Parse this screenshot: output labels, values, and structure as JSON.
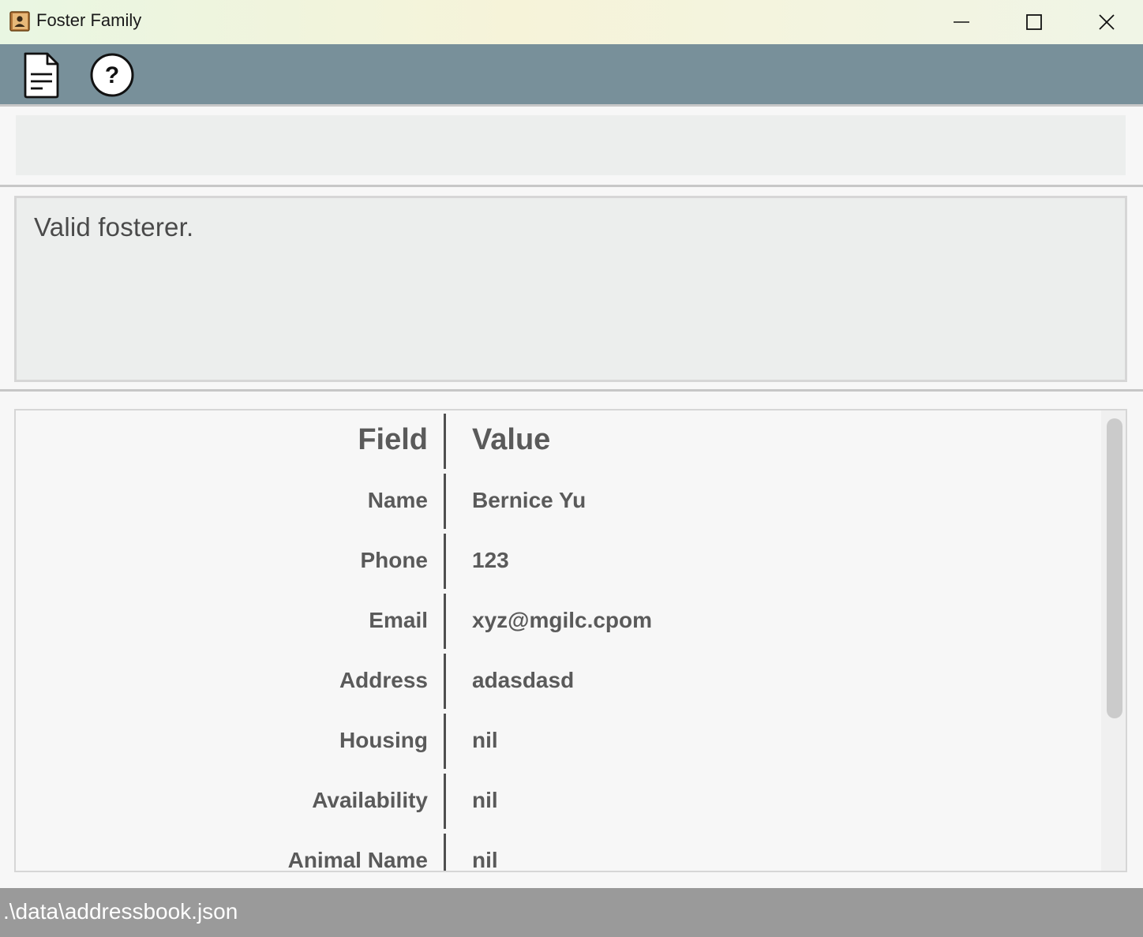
{
  "window": {
    "title": "Foster Family",
    "minimize_icon": "minimize-icon",
    "maximize_icon": "maximize-icon",
    "close_icon": "close-icon"
  },
  "toolbar": {
    "items": [
      {
        "icon": "file-icon"
      },
      {
        "icon": "help-icon"
      }
    ],
    "background": "#78909a"
  },
  "command": {
    "value": "",
    "placeholder": ""
  },
  "result": {
    "message": "Valid fosterer."
  },
  "details_table": {
    "columns": [
      "Field",
      "Value"
    ],
    "rows": [
      {
        "field": "Name",
        "value": "Bernice Yu"
      },
      {
        "field": "Phone",
        "value": "123"
      },
      {
        "field": "Email",
        "value": "xyz@mgilc.cpom"
      },
      {
        "field": "Address",
        "value": "adasdasd"
      },
      {
        "field": "Housing",
        "value": "nil"
      },
      {
        "field": "Availability",
        "value": "nil"
      },
      {
        "field": "Animal Name",
        "value": "nil"
      }
    ]
  },
  "status": {
    "file_path": ".\\data\\addressbook.json"
  }
}
